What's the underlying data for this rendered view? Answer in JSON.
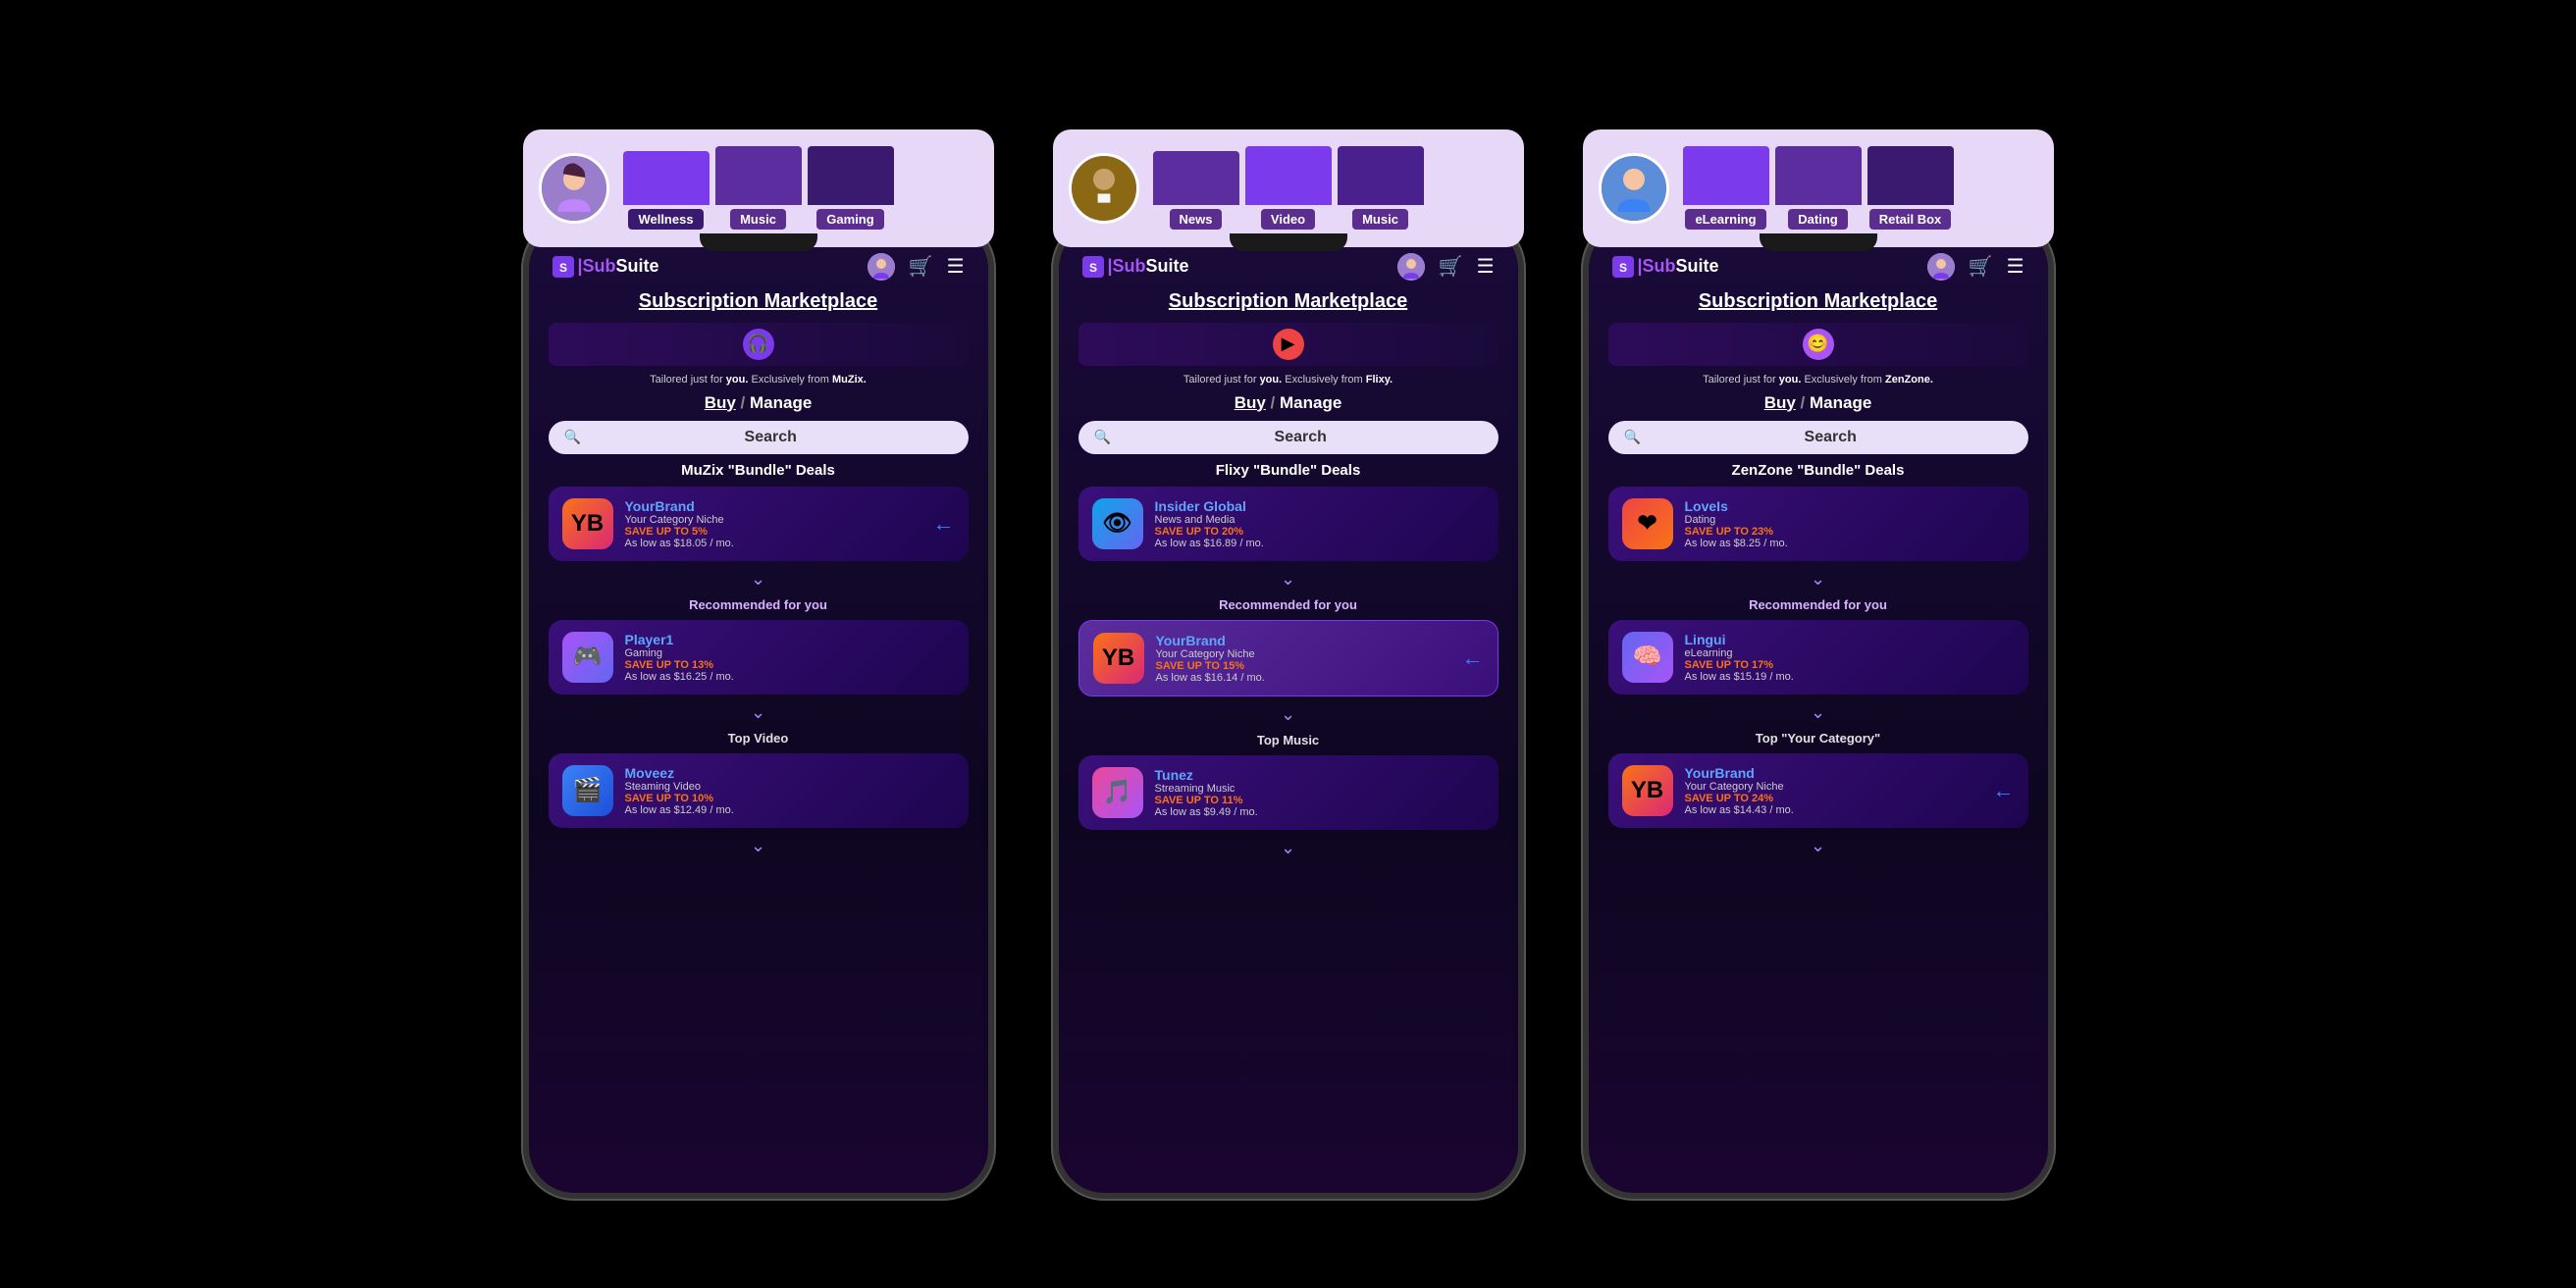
{
  "phones": [
    {
      "id": "phone1",
      "banner": {
        "bg": "#e8d8f8",
        "avatar_color": "#9b7ecb",
        "avatar_type": "woman",
        "bars": [
          {
            "color": "#7c3aed",
            "height": 55,
            "label": "Wellness",
            "active": true
          },
          {
            "color": "#5b2d9e",
            "height": 70,
            "label": "Music",
            "active": false
          },
          {
            "color": "#3a1a6e",
            "height": 85,
            "label": "Gaming",
            "active": false
          }
        ]
      },
      "logo": "SubSuite",
      "title": "Subscription Marketplace",
      "banner_icon": "🎧",
      "banner_icon_bg": "#7c3aed",
      "tailored": "Tailored just for",
      "tailored_you": "you.",
      "tailored_from": "Exclusively from",
      "brand": "MuZix.",
      "buy_label": "Buy",
      "manage_label": "Manage",
      "search_placeholder": "Search",
      "bundle_title": "MuZix \"Bundle\" Deals",
      "bundle_card": {
        "logo_bg": "linear-gradient(135deg,#f97316,#db2777)",
        "logo_text": "YB",
        "name": "YourBrand",
        "sub": "Your Category Niche",
        "save": "SAVE UP TO 5%",
        "price": "As low as $18.05 / mo.",
        "has_arrow": true
      },
      "recommended_title": "Recommended for you",
      "recommended_card": {
        "logo_bg": "linear-gradient(135deg,#a855f7,#6366f1)",
        "logo_text": "🎮",
        "name": "Player1",
        "sub": "Gaming",
        "save": "SAVE UP TO 13%",
        "price": "As low as $16.25 / mo.",
        "has_arrow": false
      },
      "top_title": "Top Video",
      "top_card": {
        "logo_bg": "linear-gradient(135deg,#3b82f6,#1d4ed8)",
        "logo_text": "🎬",
        "name": "Moveez",
        "sub": "Steaming Video",
        "save": "SAVE UP TO 10%",
        "price": "As low as $12.49 / mo.",
        "has_arrow": false
      }
    },
    {
      "id": "phone2",
      "banner": {
        "bg": "#e8d8f8",
        "avatar_color": "#8b6914",
        "avatar_type": "man",
        "bars": [
          {
            "color": "#5b2d9e",
            "height": 55,
            "label": "News",
            "active": false
          },
          {
            "color": "#7c3aed",
            "height": 72,
            "label": "Video",
            "active": false
          },
          {
            "color": "#4a1f8e",
            "height": 60,
            "label": "Music",
            "active": false
          }
        ]
      },
      "logo": "SubSuite",
      "title": "Subscription Marketplace",
      "banner_icon": "▶",
      "banner_icon_bg": "#ef4444",
      "tailored": "Tailored just for",
      "tailored_you": "you.",
      "tailored_from": "Exclusively from",
      "brand": "Flixy.",
      "buy_label": "Buy",
      "manage_label": "Manage",
      "search_placeholder": "Search",
      "bundle_title": "Flixy \"Bundle\" Deals",
      "bundle_card": {
        "logo_bg": "linear-gradient(135deg,#0ea5e9,#6366f1)",
        "logo_text": "👁",
        "name": "Insider Global",
        "sub": "News and Media",
        "save": "SAVE UP TO 20%",
        "price": "As low as $16.89 / mo.",
        "has_arrow": false
      },
      "recommended_title": "Recommended for you",
      "recommended_card": {
        "logo_bg": "linear-gradient(135deg,#f97316,#db2777)",
        "logo_text": "YB",
        "name": "YourBrand",
        "sub": "Your Category Niche",
        "save": "SAVE UP TO 15%",
        "price": "As low as $16.14 / mo.",
        "has_arrow": true
      },
      "top_title": "Top Music",
      "top_card": {
        "logo_bg": "linear-gradient(135deg,#ec4899,#a855f7)",
        "logo_text": "🎵",
        "name": "Tunez",
        "sub": "Streaming Music",
        "save": "SAVE UP TO 11%",
        "price": "As low as $9.49 / mo.",
        "has_arrow": false
      }
    },
    {
      "id": "phone3",
      "banner": {
        "bg": "#e8d8f8",
        "avatar_color": "#5b8dd9",
        "avatar_type": "boy",
        "bars": [
          {
            "color": "#7c3aed",
            "height": 60,
            "label": "eLearning",
            "active": false
          },
          {
            "color": "#5b2d9e",
            "height": 80,
            "label": "Dating",
            "active": false
          },
          {
            "color": "#3a1a6e",
            "height": 90,
            "label": "Retail Box",
            "active": false
          }
        ]
      },
      "logo": "SubSuite",
      "title": "Subscription Marketplace",
      "banner_icon": "😊",
      "banner_icon_bg": "#a855f7",
      "tailored": "Tailored just for",
      "tailored_you": "you.",
      "tailored_from": "Exclusively from",
      "brand": "ZenZone.",
      "buy_label": "Buy",
      "manage_label": "Manage",
      "search_placeholder": "Search",
      "bundle_title": "ZenZone \"Bundle\" Deals",
      "bundle_card": {
        "logo_bg": "linear-gradient(135deg,#ef4444,#f97316)",
        "logo_text": "❤",
        "name": "LoveIs",
        "sub": "Dating",
        "save": "SAVE UP TO 23%",
        "price": "As low as $8.25 / mo.",
        "has_arrow": false
      },
      "recommended_title": "Recommended for you",
      "recommended_card": {
        "logo_bg": "linear-gradient(135deg,#6366f1,#a855f7)",
        "logo_text": "🧠",
        "name": "Lingui",
        "sub": "eLearning",
        "save": "SAVE UP TO 17%",
        "price": "As low as $15.19 / mo.",
        "has_arrow": false
      },
      "top_title": "Top \"Your Category\"",
      "top_card": {
        "logo_bg": "linear-gradient(135deg,#f97316,#db2777)",
        "logo_text": "YB",
        "name": "YourBrand",
        "sub": "Your Category Niche",
        "save": "SAVE UP TO 24%",
        "price": "As low as $14.43 / mo.",
        "has_arrow": true
      }
    }
  ]
}
